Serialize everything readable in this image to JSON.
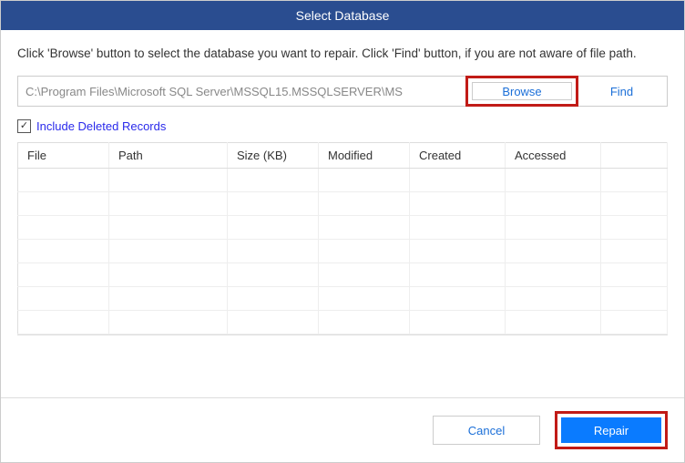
{
  "title": "Select Database",
  "instruction": "Click 'Browse' button to select the database you want to repair. Click 'Find' button, if you are not aware of file path.",
  "path_value": "C:\\Program Files\\Microsoft SQL Server\\MSSQL15.MSSQLSERVER\\MS",
  "buttons": {
    "browse": "Browse",
    "find": "Find",
    "cancel": "Cancel",
    "repair": "Repair"
  },
  "checkbox": {
    "label": "Include Deleted Records",
    "checked": true
  },
  "table": {
    "headers": [
      "File",
      "Path",
      "Size (KB)",
      "Modified",
      "Created",
      "Accessed"
    ],
    "rows": []
  },
  "highlight_color": "#c11b17",
  "accent_color": "#0a7bff"
}
